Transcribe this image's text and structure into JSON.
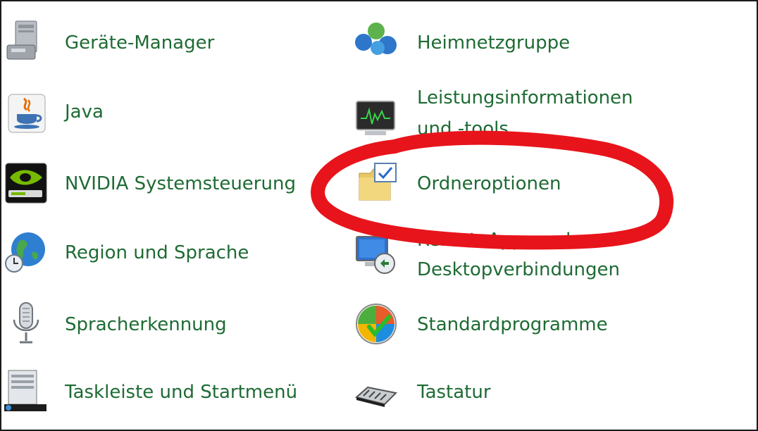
{
  "control_panel": {
    "left_column": [
      {
        "label": "Geräte-Manager",
        "icon": "device-manager-icon"
      },
      {
        "label": "Java",
        "icon": "java-icon"
      },
      {
        "label": "NVIDIA Systemsteuerung",
        "icon": "nvidia-icon"
      },
      {
        "label": "Region und Sprache",
        "icon": "globe-clock-icon"
      },
      {
        "label": "Spracherkennung",
        "icon": "microphone-icon"
      },
      {
        "label": "Taskleiste und Startmenü",
        "icon": "taskbar-icon"
      }
    ],
    "right_column": [
      {
        "label": "Heimnetzgruppe",
        "icon": "homegroup-icon"
      },
      {
        "label_line1": "Leistungsinformationen",
        "label_line2": "und -tools",
        "icon": "performance-monitor-icon"
      },
      {
        "label": "Ordneroptionen",
        "icon": "folder-options-icon"
      },
      {
        "label_line1": "RemoteApp- und",
        "label_line2": "Desktopverbindungen",
        "icon": "remote-desktop-icon"
      },
      {
        "label": "Standardprogramme",
        "icon": "default-programs-icon"
      },
      {
        "label": "Tastatur",
        "icon": "keyboard-icon"
      }
    ]
  },
  "colors": {
    "link_text": "#1e6b34",
    "annotation_ellipse": "#e8141b"
  }
}
